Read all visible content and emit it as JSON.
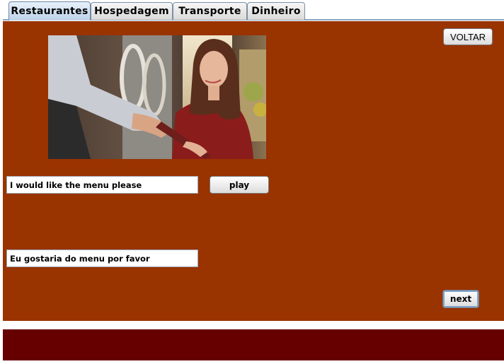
{
  "tabs": [
    {
      "label": "Restaurantes",
      "active": true
    },
    {
      "label": "Hospedagem",
      "active": false
    },
    {
      "label": "Transporte",
      "active": false
    },
    {
      "label": "Dinheiro",
      "active": false
    }
  ],
  "buttons": {
    "back_label": "VOLTAR",
    "play_label": "play",
    "next_label": "next"
  },
  "phrases": {
    "english": "I would like the menu please",
    "portuguese": "Eu gostaria do menu por favor"
  },
  "colors": {
    "panel_bg": "#993300",
    "footer_bg": "#660000"
  }
}
